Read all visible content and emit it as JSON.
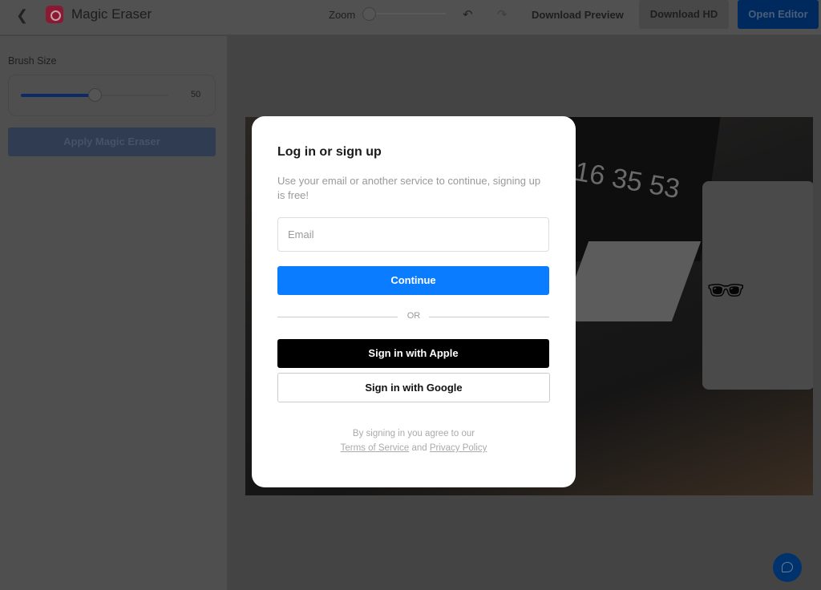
{
  "header": {
    "title": "Magic Eraser",
    "zoom_label": "Zoom",
    "download_preview": "Download Preview",
    "download_hd": "Download HD",
    "open_editor": "Open Editor"
  },
  "sidebar": {
    "brush_size_label": "Brush Size",
    "brush_size_value": "50",
    "brush_size_percent": 50,
    "apply_label": "Apply Magic Eraser"
  },
  "photo": {
    "clock_text": "16 35 53"
  },
  "modal": {
    "title": "Log in or sign up",
    "subtitle": "Use your email or another service to continue, signing up is free!",
    "email_placeholder": "Email",
    "continue_label": "Continue",
    "or_label": "OR",
    "apple_label": "Sign in with Apple",
    "google_label": "Sign in with Google",
    "legal_prefix": "By signing in you agree to our",
    "terms_label": "Terms of Service",
    "and_label": "and",
    "privacy_label": "Privacy Policy"
  },
  "colors": {
    "accent": "#0a7cff",
    "brand": "#d81f4f"
  }
}
